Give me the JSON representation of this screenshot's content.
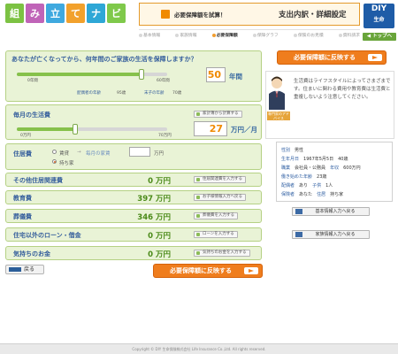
{
  "header": {
    "logo_chars": [
      "組",
      "み",
      "立",
      "て",
      "ナ",
      "ビ"
    ],
    "logo_colors": [
      "#7cc243",
      "#c064b8",
      "#3fa9df",
      "#f2a12c",
      "#2ea7d6",
      "#7fc94b"
    ],
    "banner_left": "必要保障額を試算！",
    "banner_right": "支出内訳・詳細設定",
    "diy_title": "DIY",
    "diy_sub": "生命",
    "top_link": "◀ トップへ"
  },
  "steps": [
    {
      "label": "基本情報",
      "active": false
    },
    {
      "label": "家族情報",
      "active": false
    },
    {
      "label": "必要保障額",
      "active": true
    },
    {
      "label": "保障グラフ",
      "active": false
    },
    {
      "label": "保険のお見積",
      "active": false
    },
    {
      "label": "資料請求",
      "active": false
    }
  ],
  "period_panel": {
    "question": "あなたが亡くなってから、何年間のご家族の生活を保障しますか？",
    "min_label": "0年間",
    "max_label": "60年間",
    "value": "50",
    "unit": "年間",
    "slider_fraction": 0.83,
    "spouse_age_label": "配偶者の年齢",
    "spouse_age": "95歳",
    "child_age_label": "末子の年齢",
    "child_age": "70歳"
  },
  "living_panel": {
    "title": "毎月の生活費",
    "min_label": "0万円",
    "max_label": "70万円",
    "value": "27",
    "unit": "万円／月",
    "slider_fraction": 0.39,
    "button": "家計簿から計算する"
  },
  "housing_panel": {
    "title": "住居費",
    "rent_label": "賃貸",
    "home_label": "持ち家",
    "rent_field_label": "毎月の家賃",
    "rent_value": "",
    "rent_unit": "万円"
  },
  "rows": [
    {
      "label": "その他住居関連費",
      "value": "0 万円",
      "button": "住居関連費を入力する"
    },
    {
      "label": "教育費",
      "value": "397 万円",
      "button": "お子様情報入力へ戻る"
    },
    {
      "label": "葬儀費",
      "value": "346 万円",
      "button": "葬儀費を入力する"
    },
    {
      "label": "住宅以外のローン・借金",
      "value": "0 万円",
      "button": "ローンを入力する"
    },
    {
      "label": "気持ちのお金",
      "value": "0 万円",
      "button": "気持ちのお金を入力する"
    }
  ],
  "reflect_button": "必要保障額に反映する",
  "back_button": "戻る",
  "advisor": {
    "text": "生活費はライフスタイルによってさまざまです。住まいに関わる費用や教育費は生活費と重複しないよう注意してください。",
    "label": "専門家のアドバイス"
  },
  "info": {
    "gender_label": "性別",
    "gender_value": "男性",
    "birth_label": "生年月日",
    "birth_value": "1967年5月5日　40歳",
    "job_label": "職業",
    "job_value": "会社員・公務員",
    "income_label": "年収",
    "income_value": "600万円",
    "years_label": "働き始めた年齢",
    "years_value": "23歳",
    "spouse_label": "配偶者",
    "spouse_value": "あり",
    "children_label": "子供",
    "children_value": "1人",
    "policy_label": "保険者",
    "policy_value": "あなた",
    "house_label": "住居",
    "house_value": "持ち家",
    "edit_basic": "基本情報入力へ戻る",
    "edit_family": "家族情報入力へ戻る"
  },
  "footer": "Copyright © DIY 生命保険株式会社 Life Insurance Co.,Ltd. All rights reserved."
}
